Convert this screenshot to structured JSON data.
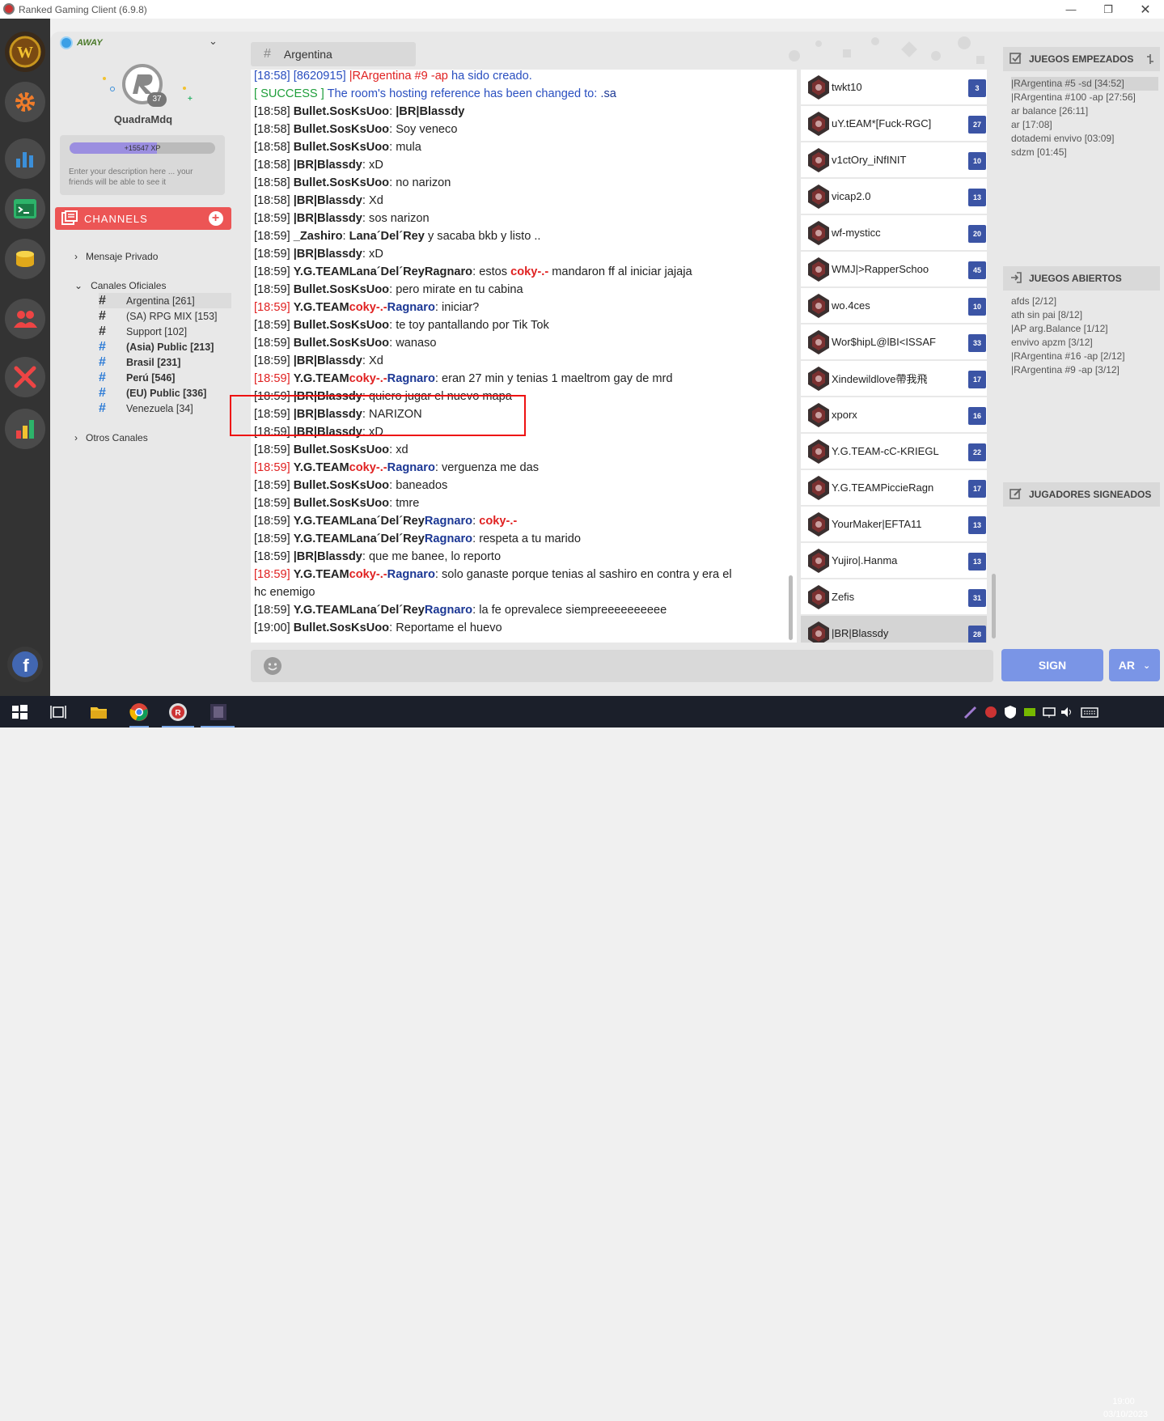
{
  "window": {
    "title": "Ranked Gaming Client (6.9.8)"
  },
  "profile": {
    "status": "AWAY",
    "username": "QuadraMdq",
    "level": "37",
    "xp": "+15547 XP",
    "xp_fraction": 0.6,
    "description_placeholder": "Enter your description here ... your friends will be able to see it"
  },
  "channels": {
    "header": "CHANNELS",
    "private": "Mensaje Privado",
    "official": "Canales Oficiales",
    "others": "Otros Canales",
    "list": [
      {
        "hash": "#",
        "name": "Argentina [261]",
        "color": "#333"
      },
      {
        "hash": "#",
        "name": "(SA) RPG MIX [153]",
        "color": "#333"
      },
      {
        "hash": "#",
        "name": "Support [102]",
        "color": "#333"
      },
      {
        "hash": "#",
        "name": "(Asia) Public [213]",
        "color": "#2a7ad6"
      },
      {
        "hash": "#",
        "name": "Brasil [231]",
        "color": "#2a7ad6"
      },
      {
        "hash": "#",
        "name": "Perú [546]",
        "color": "#2a7ad6"
      },
      {
        "hash": "#",
        "name": "(EU) Public [336]",
        "color": "#2a7ad6"
      },
      {
        "hash": "#",
        "name": "Venezuela [34]",
        "color": "#2a7ad6"
      }
    ]
  },
  "room": {
    "hash": "#",
    "name": "Argentina"
  },
  "chat": [
    {
      "t": "[18:58]",
      "parts": [
        {
          "c": "blue",
          "x": "[8620915] "
        },
        {
          "c": "red",
          "x": "|RArgentina #9 -ap "
        },
        {
          "c": "blue",
          "x": "ha sido creado."
        }
      ]
    },
    {
      "t": "",
      "parts": [
        {
          "c": "green",
          "x": "[ SUCCESS ] "
        },
        {
          "c": "blue",
          "x": "The room's hosting reference has been changed to: "
        },
        {
          "c": "navy",
          "x": ".sa"
        }
      ]
    },
    {
      "t": "[18:58]",
      "parts": [
        {
          "c": "b",
          "x": "Bullet.SosKsUoo"
        },
        {
          "c": "",
          "x": ": "
        },
        {
          "c": "b",
          "x": "|BR|Blassdy"
        }
      ]
    },
    {
      "t": "[18:58]",
      "parts": [
        {
          "c": "b",
          "x": "Bullet.SosKsUoo"
        },
        {
          "c": "",
          "x": ": Soy veneco"
        }
      ]
    },
    {
      "t": "[18:58]",
      "parts": [
        {
          "c": "b",
          "x": "Bullet.SosKsUoo"
        },
        {
          "c": "",
          "x": ": mula"
        }
      ]
    },
    {
      "t": "[18:58]",
      "parts": [
        {
          "c": "b",
          "x": " |BR|Blassdy"
        },
        {
          "c": "",
          "x": ": xD"
        }
      ]
    },
    {
      "t": "[18:58]",
      "parts": [
        {
          "c": "b",
          "x": "Bullet.SosKsUoo"
        },
        {
          "c": "",
          "x": ": no narizon"
        }
      ]
    },
    {
      "t": "[18:58]",
      "parts": [
        {
          "c": "b",
          "x": " |BR|Blassdy"
        },
        {
          "c": "",
          "x": ": Xd"
        }
      ]
    },
    {
      "t": "[18:59]",
      "parts": [
        {
          "c": "b",
          "x": " |BR|Blassdy"
        },
        {
          "c": "",
          "x": ": sos narizon"
        }
      ]
    },
    {
      "t": "[18:59]",
      "parts": [
        {
          "c": "b",
          "x": "_Zashiro"
        },
        {
          "c": "",
          "x": ": "
        },
        {
          "c": "b",
          "x": "Lana´Del´Rey"
        },
        {
          "c": "",
          "x": " y sacaba bkb y listo .."
        }
      ]
    },
    {
      "t": "[18:59]",
      "parts": [
        {
          "c": "b",
          "x": " |BR|Blassdy"
        },
        {
          "c": "",
          "x": ": xD"
        }
      ]
    },
    {
      "t": "[18:59]",
      "parts": [
        {
          "c": "b",
          "x": "Y.G.TEAMLana´Del´ReyRagnaro"
        },
        {
          "c": "",
          "x": ": estos "
        },
        {
          "c": "redb",
          "x": "coky-.-"
        },
        {
          "c": "",
          "x": " mandaron ff al iniciar jajaja"
        }
      ]
    },
    {
      "t": "[18:59]",
      "parts": [
        {
          "c": "b",
          "x": "Bullet.SosKsUoo"
        },
        {
          "c": "",
          "x": ": pero mirate en tu cabina"
        }
      ]
    },
    {
      "t": "[18:59]",
      "tc": "red",
      "parts": [
        {
          "c": "b",
          "x": "Y.G.TEAM"
        },
        {
          "c": "redb",
          "x": "coky-.-"
        },
        {
          "c": "navyb",
          "x": "Ragnaro"
        },
        {
          "c": "",
          "x": ": iniciar?"
        }
      ]
    },
    {
      "t": "[18:59]",
      "parts": [
        {
          "c": "b",
          "x": "Bullet.SosKsUoo"
        },
        {
          "c": "",
          "x": ": te toy pantallando por Tik Tok"
        }
      ]
    },
    {
      "t": "[18:59]",
      "parts": [
        {
          "c": "b",
          "x": "Bullet.SosKsUoo"
        },
        {
          "c": "",
          "x": ": wanaso"
        }
      ]
    },
    {
      "t": "[18:59]",
      "parts": [
        {
          "c": "b",
          "x": " |BR|Blassdy"
        },
        {
          "c": "",
          "x": ": Xd"
        }
      ]
    },
    {
      "t": "[18:59]",
      "tc": "red",
      "parts": [
        {
          "c": "b",
          "x": "Y.G.TEAM"
        },
        {
          "c": "redb",
          "x": "coky-.-"
        },
        {
          "c": "navyb",
          "x": "Ragnaro"
        },
        {
          "c": "",
          "x": ": eran 27 min y tenias 1 maeltrom gay de mrd"
        }
      ]
    },
    {
      "t": "[18:59]",
      "parts": [
        {
          "c": "b",
          "x": " |BR|Blassdy"
        },
        {
          "c": "",
          "x": ": quiero jugar el nuevo mapa"
        }
      ]
    },
    {
      "t": "[18:59]",
      "parts": [
        {
          "c": "b",
          "x": " |BR|Blassdy"
        },
        {
          "c": "",
          "x": ": NARIZON"
        }
      ]
    },
    {
      "t": "[18:59]",
      "parts": [
        {
          "c": "b",
          "x": " |BR|Blassdy"
        },
        {
          "c": "",
          "x": ": xD"
        }
      ]
    },
    {
      "t": "[18:59]",
      "parts": [
        {
          "c": "b",
          "x": "Bullet.SosKsUoo"
        },
        {
          "c": "",
          "x": ": xd"
        }
      ]
    },
    {
      "t": "[18:59]",
      "tc": "red",
      "parts": [
        {
          "c": "b",
          "x": "Y.G.TEAM"
        },
        {
          "c": "redb",
          "x": "coky-.-"
        },
        {
          "c": "navyb",
          "x": "Ragnaro"
        },
        {
          "c": "",
          "x": ": verguenza me das"
        }
      ]
    },
    {
      "t": "[18:59]",
      "parts": [
        {
          "c": "b",
          "x": "Bullet.SosKsUoo"
        },
        {
          "c": "",
          "x": ": baneados"
        }
      ]
    },
    {
      "t": "[18:59]",
      "parts": [
        {
          "c": "b",
          "x": "Bullet.SosKsUoo"
        },
        {
          "c": "",
          "x": ": tmre"
        }
      ]
    },
    {
      "t": "[18:59]",
      "parts": [
        {
          "c": "b",
          "x": "Y.G.TEAMLana´Del´Rey"
        },
        {
          "c": "navyb",
          "x": "Ragnaro"
        },
        {
          "c": "",
          "x": ": "
        },
        {
          "c": "redb",
          "x": "coky-.-"
        }
      ]
    },
    {
      "t": "[18:59]",
      "parts": [
        {
          "c": "b",
          "x": "Y.G.TEAMLana´Del´Rey"
        },
        {
          "c": "navyb",
          "x": "Ragnaro"
        },
        {
          "c": "",
          "x": ": respeta a tu marido"
        }
      ]
    },
    {
      "t": "[18:59]",
      "parts": [
        {
          "c": "b",
          "x": " |BR|Blassdy"
        },
        {
          "c": "",
          "x": ": que me banee, lo reporto"
        }
      ]
    },
    {
      "t": "[18:59]",
      "tc": "red",
      "parts": [
        {
          "c": "b",
          "x": "Y.G.TEAM"
        },
        {
          "c": "redb",
          "x": "coky-.-"
        },
        {
          "c": "navyb",
          "x": "Ragnaro"
        },
        {
          "c": "",
          "x": ": solo ganaste porque tenias al sashiro en contra y era el"
        }
      ]
    },
    {
      "t": "",
      "parts": [
        {
          "c": "",
          "x": "hc enemigo"
        }
      ]
    },
    {
      "t": "[18:59]",
      "parts": [
        {
          "c": "b",
          "x": "Y.G.TEAMLana´Del´Rey"
        },
        {
          "c": "navyb",
          "x": "Ragnaro"
        },
        {
          "c": "",
          "x": ": la fe oprevalece siempreeeeeeeeee"
        }
      ]
    },
    {
      "t": "[19:00]",
      "parts": [
        {
          "c": "b",
          "x": "Bullet.SosKsUoo"
        },
        {
          "c": "",
          "x": ": Reportame el huevo"
        }
      ]
    }
  ],
  "users": [
    {
      "name": "twkt10",
      "level": "3"
    },
    {
      "name": "uY.tEAM*[Fuck-RGC]",
      "level": "27"
    },
    {
      "name": "v1ctOry_iNfINIT",
      "level": "10"
    },
    {
      "name": "vicap2.0",
      "level": "13"
    },
    {
      "name": "wf-mysticc",
      "level": "20"
    },
    {
      "name": "WMJ|>RapperSchoo",
      "level": "45"
    },
    {
      "name": "wo.4ces",
      "level": "10"
    },
    {
      "name": "Wor$hipL@lBI<ISSAF",
      "level": "33"
    },
    {
      "name": "Xindewildlove帶我飛",
      "level": "17"
    },
    {
      "name": "xporx",
      "level": "16"
    },
    {
      "name": "Y.G.TEAM-cC-KRIEGL",
      "level": "22"
    },
    {
      "name": "Y.G.TEAMPiccieRagn",
      "level": "17"
    },
    {
      "name": "YourMaker|EFTA11",
      "level": "13"
    },
    {
      "name": "Yujiro|.Hanma",
      "level": "13"
    },
    {
      "name": "Zefis",
      "level": "31"
    },
    {
      "name": "|BR|Blassdy",
      "level": "28"
    }
  ],
  "games_started": {
    "title": "JUEGOS EMPEZADOS",
    "items": [
      "|RArgentina #5 -sd [34:52]",
      "|RArgentina #100 -ap [27:56]",
      "ar balance [26:11]",
      "ar [17:08]",
      "dotademi envivo [03:09]",
      "sdzm [01:45]"
    ]
  },
  "games_open": {
    "title": "JUEGOS ABIERTOS",
    "items": [
      "afds [2/12]",
      "ath sin pai [8/12]",
      "|AP arg.Balance [1/12]",
      "envivo apzm [3/12]",
      "|RArgentina #16 -ap [2/12]",
      "|RArgentina #9 -ap [3/12]"
    ]
  },
  "signed_players": {
    "title": "JUGADORES SIGNEADOS"
  },
  "buttons": {
    "sign": "SIGN",
    "lang": "AR"
  },
  "taskbar": {
    "time": "19:00",
    "date": "03/10/2023"
  }
}
